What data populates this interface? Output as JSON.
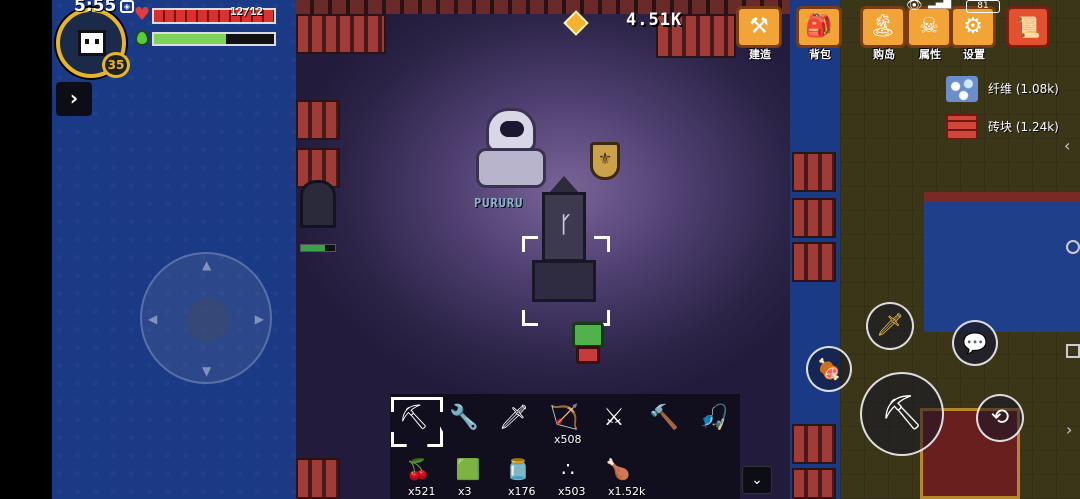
{
  "status": {
    "time": "5:55",
    "battery": "81"
  },
  "player": {
    "level": "35",
    "hp_text": "12/12",
    "hp_fraction": 1.0,
    "energy_fraction": 0.6
  },
  "currency": {
    "amount": "4.51K"
  },
  "menu": [
    {
      "label": "建造",
      "icon": "build-icon"
    },
    {
      "label": "背包",
      "icon": "backpack-icon"
    },
    {
      "label": "购岛",
      "icon": "island-icon"
    },
    {
      "label": "属性",
      "icon": "attributes-icon"
    },
    {
      "label": "设置",
      "icon": "settings-icon"
    }
  ],
  "resources": [
    {
      "label": "纤维 (1.08k)",
      "icon": "fiber-icon"
    },
    {
      "label": "砖块 (1.24k)",
      "icon": "brick-icon"
    }
  ],
  "npc": {
    "name": "PURURU"
  },
  "hotbar": {
    "tools": [
      {
        "icon": "pickaxe-icon",
        "count": ""
      },
      {
        "icon": "shovel-icon",
        "count": ""
      },
      {
        "icon": "sword-icon",
        "count": ""
      },
      {
        "icon": "bow-icon",
        "count": "x508"
      },
      {
        "icon": "golden-sword-icon",
        "count": ""
      },
      {
        "icon": "hammer-icon",
        "count": ""
      },
      {
        "icon": "fishing-rod-icon",
        "count": ""
      }
    ],
    "items": [
      {
        "icon": "berries-icon",
        "count": "x521"
      },
      {
        "icon": "grass-block-icon",
        "count": "x3"
      },
      {
        "icon": "bottle-icon",
        "count": "x176"
      },
      {
        "icon": "seeds-icon",
        "count": "x503"
      },
      {
        "icon": "meat-icon",
        "count": "x1.52k"
      }
    ]
  },
  "colors": {
    "hp": "#d93030",
    "energy": "#7ed45a",
    "menu_tile": "#f3a436",
    "level_ring": "#e7b529"
  }
}
